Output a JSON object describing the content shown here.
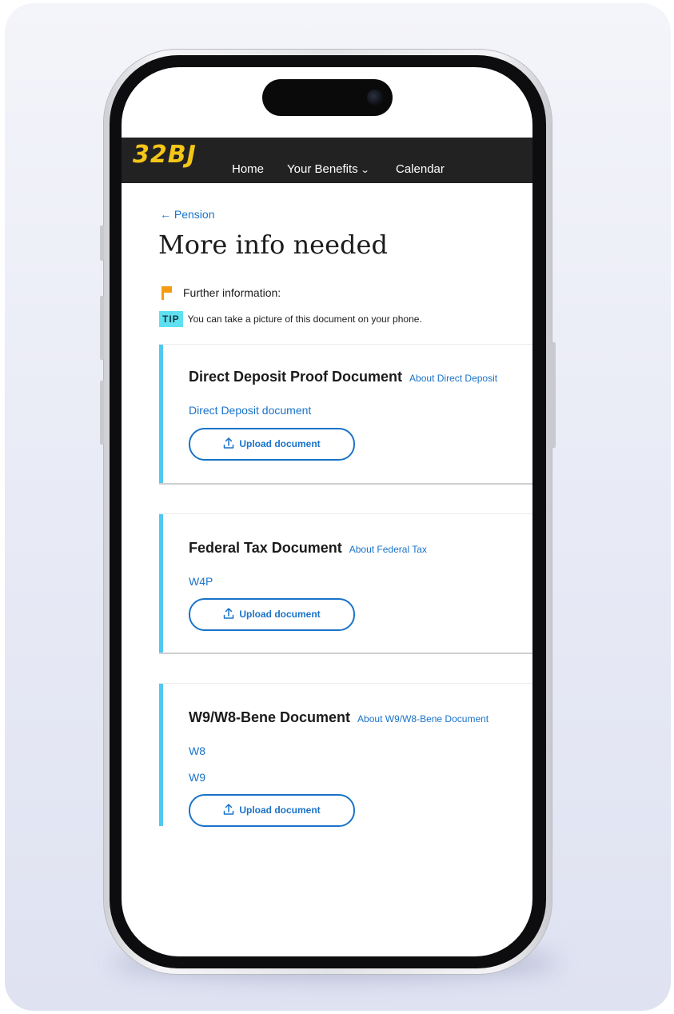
{
  "nav": {
    "logo": "32BJ",
    "items": [
      {
        "label": "Home"
      },
      {
        "label": "Your Benefits"
      },
      {
        "label": "Calendar"
      }
    ]
  },
  "breadcrumb": {
    "back_label": "← Pension"
  },
  "page": {
    "title": "More info needed",
    "further_info_label": "Further information:",
    "tip_badge": "TIP",
    "tip_text": "You can take a picture of this document on your phone."
  },
  "documents": [
    {
      "title": "Direct Deposit Proof Document",
      "about_link": "About Direct Deposit",
      "links": [
        "Direct Deposit document"
      ],
      "upload_label": "Upload document"
    },
    {
      "title": "Federal Tax Document",
      "about_link": "About Federal Tax",
      "links": [
        "W4P"
      ],
      "upload_label": "Upload document"
    },
    {
      "title": "W9/W8-Bene Document",
      "about_link": "About W9/W8-Bene Document",
      "links": [
        "W8",
        "W9"
      ],
      "upload_label": "Upload document"
    }
  ],
  "icons": {
    "back": "arrow-left-icon",
    "flag": "flag-icon",
    "upload": "upload-icon",
    "dropdown": "chevron-down-icon"
  },
  "colors": {
    "nav_background": "#222222",
    "logo": "#f5c518",
    "link": "#1a73c9",
    "card_accent": "#50c8f0",
    "tip_badge": "#5fe0f0",
    "flag": "#f39c12"
  }
}
